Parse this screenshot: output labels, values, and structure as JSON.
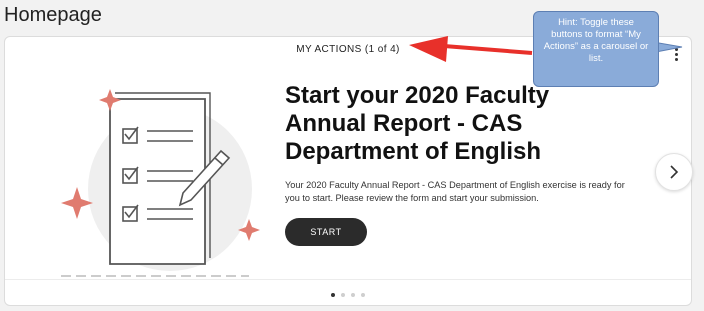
{
  "page": {
    "title": "Homepage"
  },
  "card": {
    "header": "MY ACTIONS (1 of 4)",
    "headline": "Start your 2020 Faculty Annual Report - CAS Department of English",
    "description": "Your 2020 Faculty Annual Report - CAS Department of English exercise is ready for you to start. Please review the form and start your submission.",
    "start_label": "START",
    "pagination": {
      "current": 1,
      "total": 4
    }
  },
  "annotation": {
    "hint": "Hint: Toggle these buttons to format “My Actions” as a carousel or list.",
    "arrow_color": "#e8302a"
  },
  "icons": {
    "menu": "kebab-menu-icon",
    "next": "chevron-right-icon",
    "illustration": "checklist-illustration"
  },
  "colors": {
    "button_bg": "#2b2b2b",
    "sparkle": "#e07b6f",
    "hint_bg": "#8aabd9"
  }
}
